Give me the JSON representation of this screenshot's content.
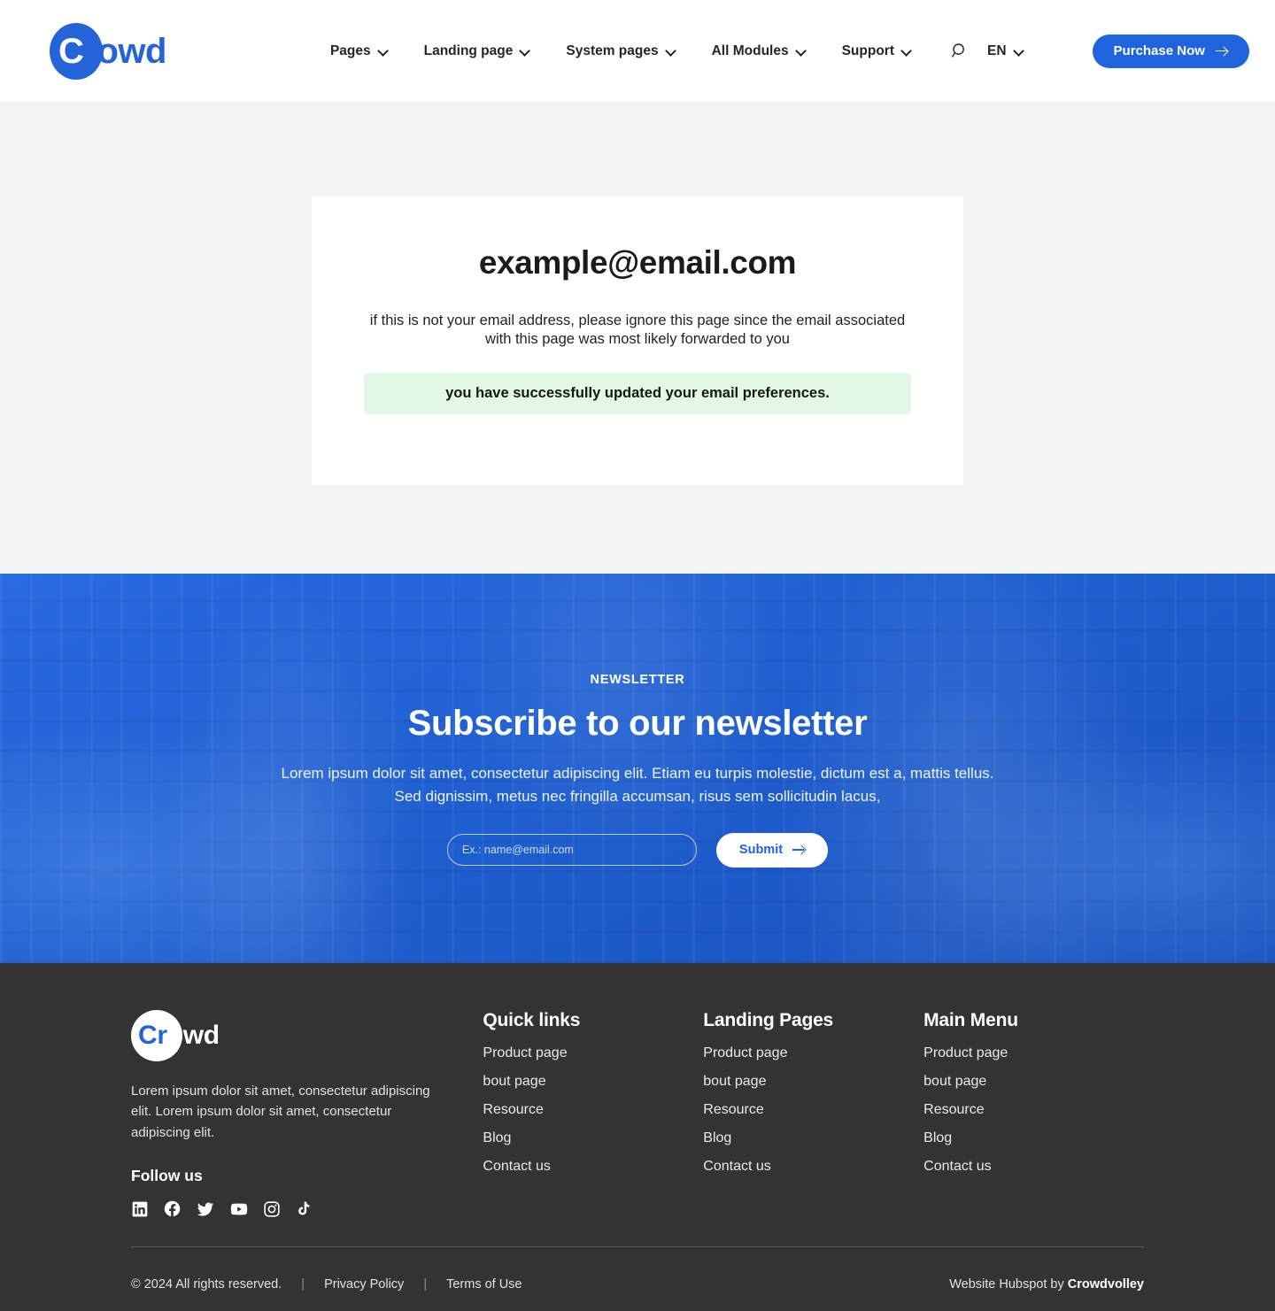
{
  "header": {
    "logo": {
      "prefix": "C",
      "rest": "rowd",
      "full": "Crowd"
    },
    "nav": [
      {
        "label": "Pages"
      },
      {
        "label": "Landing page"
      },
      {
        "label": "System pages"
      },
      {
        "label": "All Modules"
      },
      {
        "label": "Support"
      }
    ],
    "search_icon": "search-icon",
    "language": "EN",
    "purchase_label": "Purchase Now",
    "accent_color": "#1f63df"
  },
  "main": {
    "email": "example@email.com",
    "note": "if this is not your email address, please ignore this page since the email associated with this page was most likely forwarded to you",
    "alert": {
      "message": "you have successfully updated your email preferences.",
      "background": "#e2f8e4"
    },
    "page_background": "#f1f4f7"
  },
  "newsletter": {
    "eyebrow": "NEWSLETTER",
    "title": "Subscribe to our newsletter",
    "description": "Lorem ipsum dolor sit amet, consectetur adipiscing elit. Etiam eu turpis molestie, dictum est a, mattis tellus. Sed dignissim, metus nec fringilla accumsan, risus sem sollicitudin lacus,",
    "input_placeholder": "Ex.: name@email.com",
    "input_value": "",
    "submit_label": "Submit",
    "background_color": "#1f5fd1"
  },
  "footer": {
    "logo": {
      "blue": "Cr",
      "white": "owd",
      "full": "Crowd"
    },
    "description": "Lorem ipsum dolor sit amet, consectetur adipiscing elit. Lorem ipsum dolor sit amet, consectetur adipiscing elit.",
    "follow_title": "Follow us",
    "socials": [
      {
        "name": "linkedin-icon"
      },
      {
        "name": "facebook-icon"
      },
      {
        "name": "twitter-icon"
      },
      {
        "name": "youtube-icon"
      },
      {
        "name": "instagram-icon"
      },
      {
        "name": "tiktok-icon"
      }
    ],
    "columns": [
      {
        "title": "Quick links",
        "links": [
          "Product page",
          "bout page",
          "Resource",
          "Blog",
          "Contact us"
        ]
      },
      {
        "title": "Landing Pages",
        "links": [
          "Product page",
          "bout page",
          "Resource",
          "Blog",
          "Contact us"
        ]
      },
      {
        "title": "Main Menu",
        "links": [
          "Product page",
          "bout page",
          "Resource",
          "Blog",
          "Contact us"
        ]
      }
    ],
    "bottom": {
      "copyright": "© 2024 All rights reserved.",
      "separator": "|",
      "privacy": "Privacy Policy",
      "terms": "Terms of Use",
      "credit_prefix": "Website Hubspot by ",
      "credit_brand": "Crowdvolley"
    },
    "background": "#333333"
  }
}
